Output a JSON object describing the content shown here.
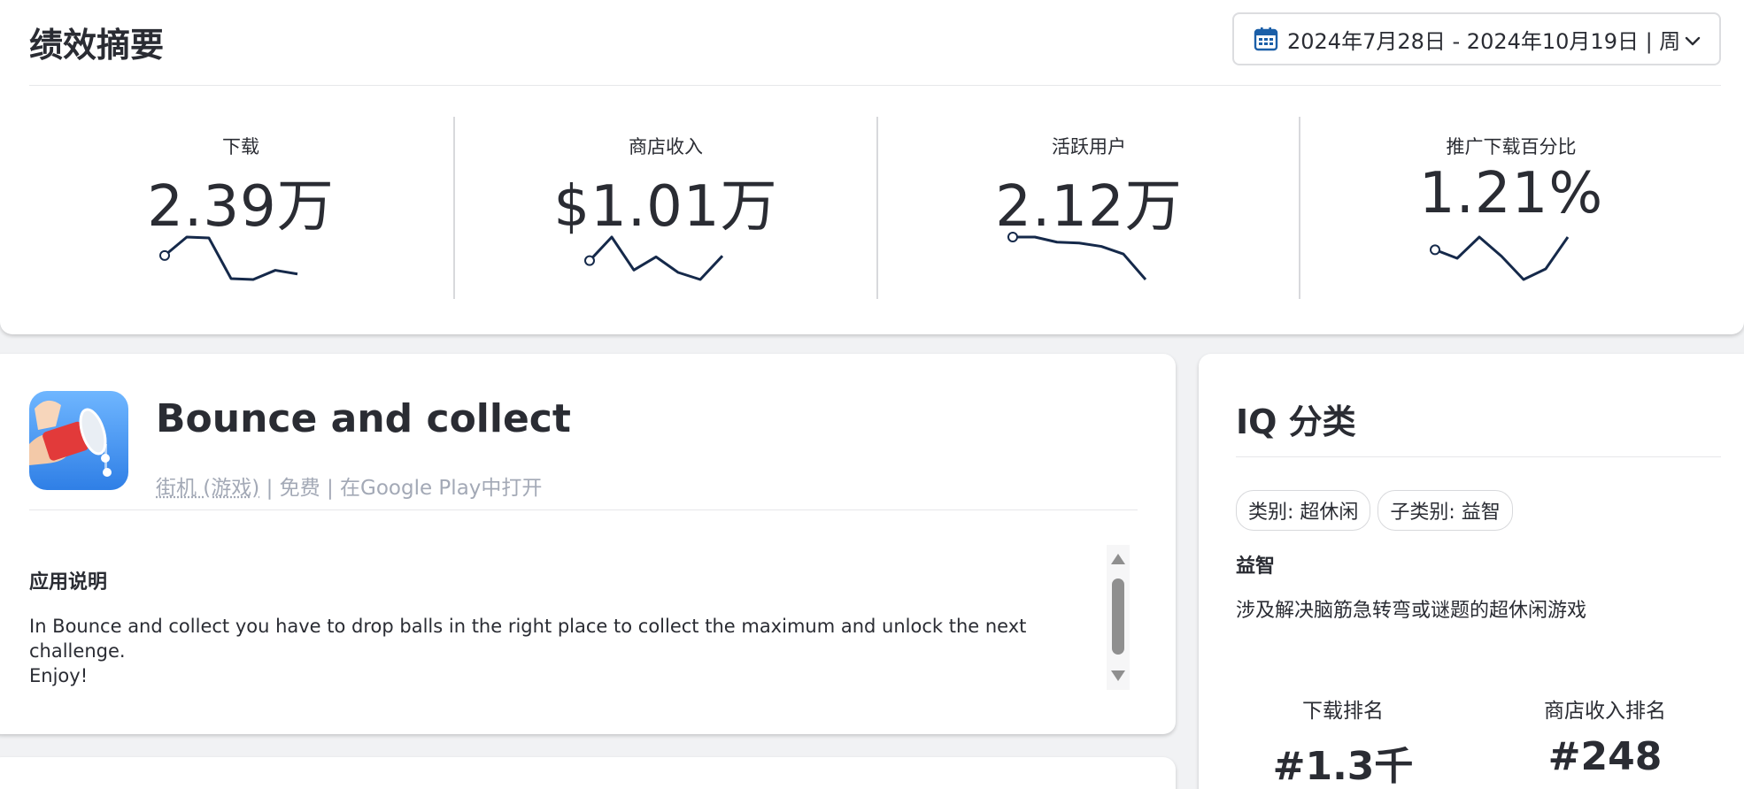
{
  "summary": {
    "title": "绩效摘要",
    "date_range": "2024年7月28日 - 2024年10月19日 | 周",
    "metrics": [
      {
        "label": "下载",
        "value": "2.39万",
        "trend": [
          0.6,
          1.0,
          0.98,
          0.1,
          0.08,
          0.28,
          0.2
        ]
      },
      {
        "label": "商店收入",
        "value": "$1.01万",
        "trend": [
          0.5,
          1.0,
          0.3,
          0.58,
          0.25,
          0.1,
          0.6
        ]
      },
      {
        "label": "活跃用户",
        "value": "2.12万",
        "trend": [
          1.0,
          1.0,
          0.88,
          0.86,
          0.78,
          0.6,
          0.0
        ]
      },
      {
        "label": "推广下载百分比",
        "value": "1.21%",
        "trend": [
          0.5,
          0.3,
          0.8,
          0.35,
          -0.2,
          0.05,
          0.8
        ]
      }
    ]
  },
  "app": {
    "name": "Bounce and collect",
    "category_link": "街机 (游戏)",
    "price": "免费",
    "store_link": "在Google Play中打开",
    "separator": "|",
    "description_title": "应用说明",
    "description": "In Bounce and collect you have to drop balls in the right place to collect the maximum and unlock the next challenge.\nEnjoy!"
  },
  "iq": {
    "title": "IQ 分类",
    "tags": [
      "类别: 超休闲",
      "子类别: 益智"
    ],
    "subcategory_title": "益智",
    "subcategory_desc": "涉及解决脑筋急转弯或谜题的超休闲游戏",
    "ranks": [
      {
        "label": "下载排名",
        "value": "#1.3千"
      },
      {
        "label": "商店收入排名",
        "value": "#248"
      }
    ]
  },
  "colors": {
    "spark": "#15294a",
    "accent_blue": "#1b5fa8",
    "muted_text": "#a3a9b6"
  }
}
